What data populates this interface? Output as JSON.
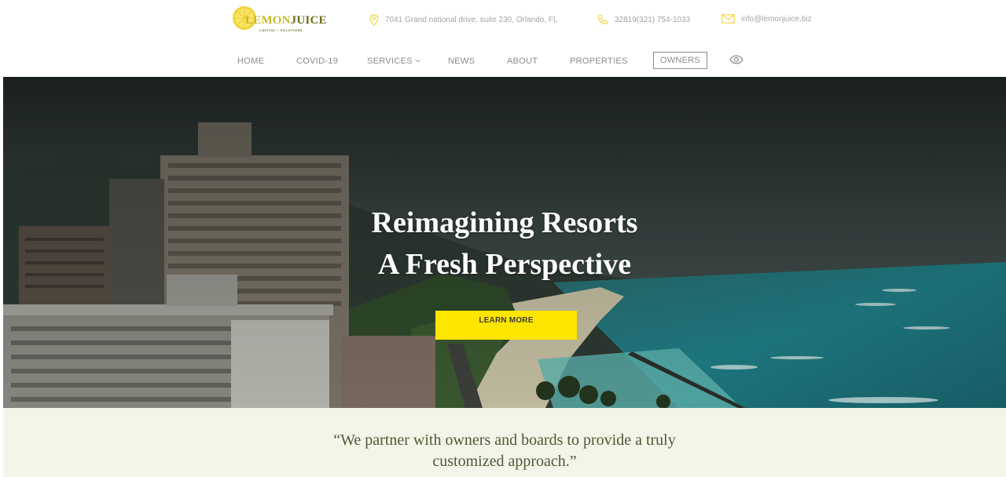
{
  "brand": {
    "logo_lemon": "LEMON",
    "logo_juice": "JUICE",
    "logo_tagline": "CAPITAL • SOLUTIONS",
    "accent_color": "#ffe600",
    "logo_yellow": "#c9b82a",
    "logo_olive": "#6a6e18"
  },
  "contact": {
    "address": "7041 Grand national drive, suite 230, Orlando, FL",
    "phone": "32819(321) 754-1033",
    "email": "info@lemonjuice.biz",
    "icons": [
      "map-pin-icon",
      "phone-icon",
      "envelope-icon"
    ]
  },
  "nav": {
    "home": "HOME",
    "covid": "COVID-19",
    "services": "SERVICES",
    "news": "NEWS",
    "about": "ABOUT",
    "properties": "PROPERTIES",
    "owners": "OWNERS",
    "icons": [
      "chevron-down-icon",
      "eye-icon"
    ]
  },
  "hero": {
    "title_line1": "Reimagining Resorts",
    "title_line2": "A Fresh Perspective",
    "button_label": "LEARN MORE"
  },
  "quote": {
    "line1": "“We partner with owners and boards to provide a truly",
    "line2": "customized approach.”",
    "background": "#f3f5e8"
  }
}
